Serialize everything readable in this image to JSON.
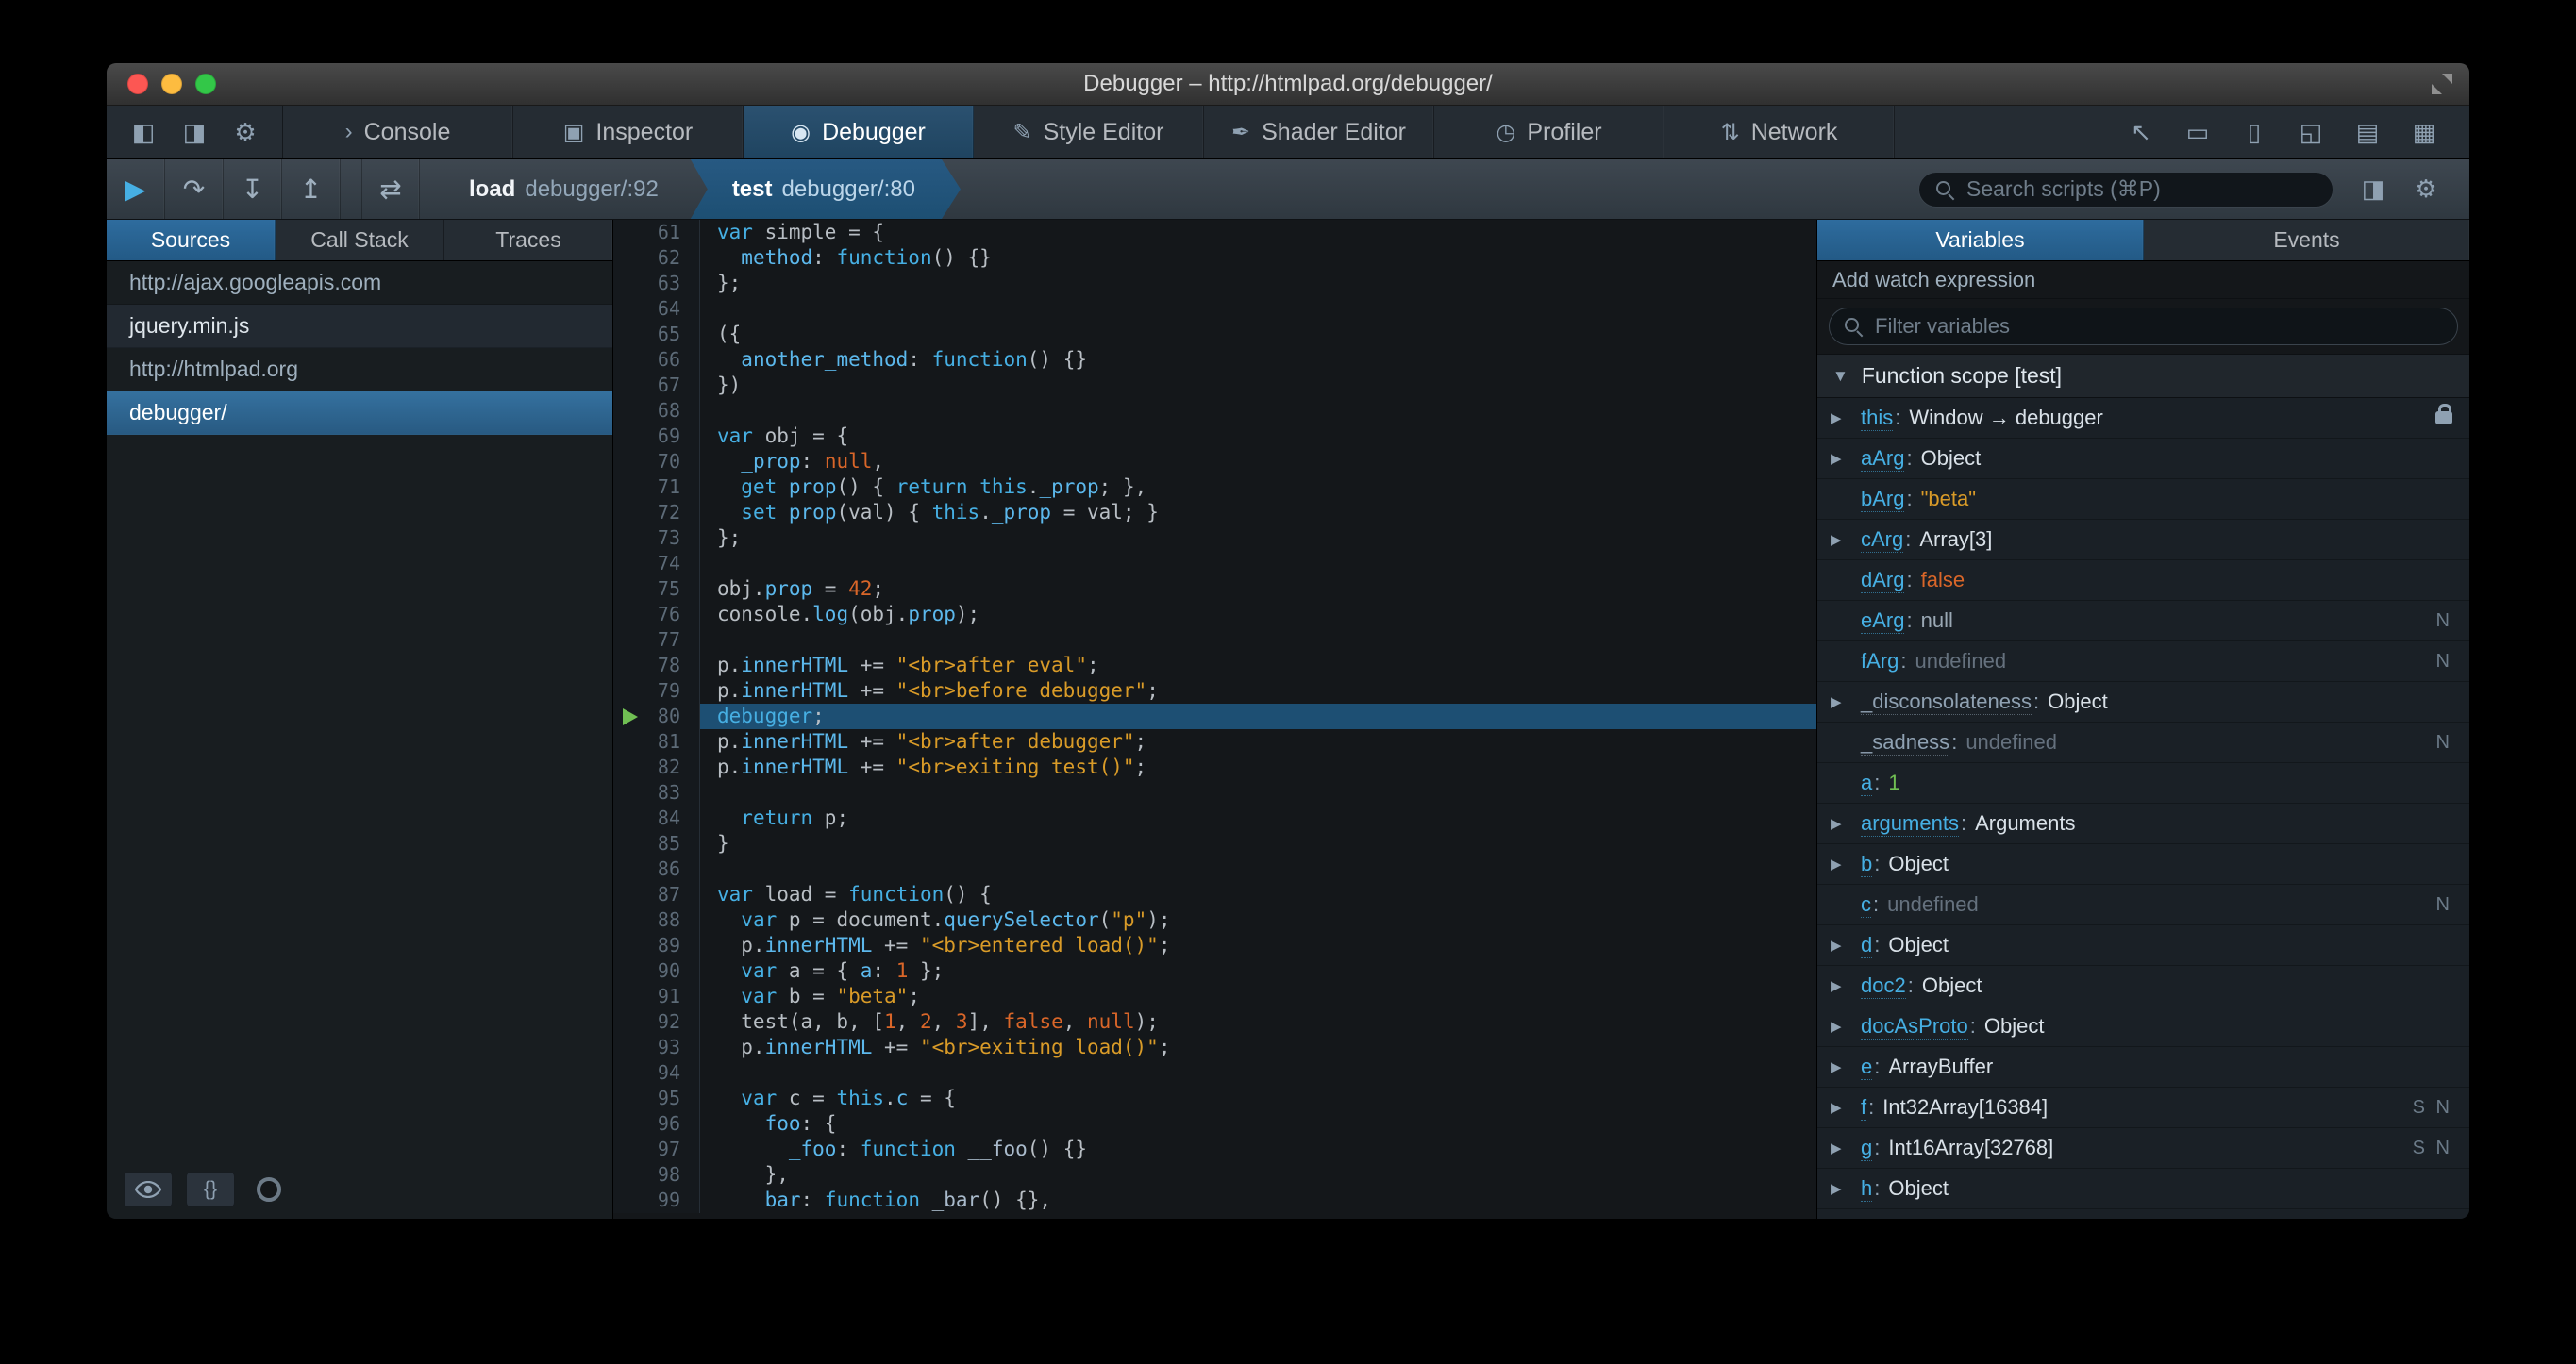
{
  "window": {
    "title": "Debugger – http://htmlpad.org/debugger/"
  },
  "colors": {
    "accent_blue": "#46afe3",
    "selection_blue": "#1d4f73",
    "string_orange": "#d99b28",
    "number_orange": "#d96629",
    "exec_green": "#70bf53",
    "panel_background": "#181d20",
    "toolbar_background": "#343c45"
  },
  "icons": {
    "caret_right": "▶",
    "caret_down": "▼"
  },
  "toolbar": {
    "left_icons": [
      {
        "name": "dock-side-icon",
        "glyph": "◧"
      },
      {
        "name": "dock-window-icon",
        "glyph": "◨"
      },
      {
        "name": "settings-gear-icon",
        "glyph": "⚙"
      }
    ],
    "tabs": [
      {
        "label": "Console",
        "icon": "console-icon",
        "glyph": "›"
      },
      {
        "label": "Inspector",
        "icon": "inspector-icon",
        "glyph": "▣"
      },
      {
        "label": "Debugger",
        "icon": "debugger-icon",
        "glyph": "◉"
      },
      {
        "label": "Style Editor",
        "icon": "style-editor-icon",
        "glyph": "✎"
      },
      {
        "label": "Shader Editor",
        "icon": "shader-editor-icon",
        "glyph": "✒"
      },
      {
        "label": "Profiler",
        "icon": "profiler-icon",
        "glyph": "◷"
      },
      {
        "label": "Network",
        "icon": "network-icon",
        "glyph": "⇅"
      }
    ],
    "active_tab": "Debugger",
    "right_icons": [
      {
        "name": "pick-element-icon",
        "glyph": "↖"
      },
      {
        "name": "split-console-icon",
        "glyph": "▭"
      },
      {
        "name": "responsive-mode-icon",
        "glyph": "▯"
      },
      {
        "name": "paint-flashing-icon",
        "glyph": "◱"
      },
      {
        "name": "scratchpad-icon",
        "glyph": "▤"
      },
      {
        "name": "tilt-3d-icon",
        "glyph": "▦"
      }
    ]
  },
  "debugger_toolbar": {
    "controls": [
      {
        "name": "resume-button",
        "glyph": "▶",
        "accent": true
      },
      {
        "name": "step-over-button",
        "glyph": "↷"
      },
      {
        "name": "step-in-button",
        "glyph": "↧"
      },
      {
        "name": "step-out-button",
        "glyph": "↥"
      },
      {
        "name": "toggle-pause-exceptions-button",
        "glyph": "⇄",
        "gap": true
      }
    ],
    "breadcrumbs": [
      {
        "fn": "load",
        "loc": "debugger/:92",
        "active": false
      },
      {
        "fn": "test",
        "loc": "debugger/:80",
        "active": true
      }
    ],
    "search_placeholder": "Search scripts (⌘P)",
    "right_icons": [
      {
        "name": "toggle-panel-icon",
        "glyph": "◨"
      },
      {
        "name": "debugger-settings-gear-icon",
        "glyph": "⚙"
      }
    ]
  },
  "sources_panel": {
    "tabs": [
      "Sources",
      "Call Stack",
      "Traces"
    ],
    "active_tab": "Sources",
    "items": [
      {
        "label": "http://ajax.googleapis.com",
        "type": "group",
        "selected": false
      },
      {
        "label": "jquery.min.js",
        "type": "file",
        "selected": false
      },
      {
        "label": "http://htmlpad.org",
        "type": "group",
        "selected": false
      },
      {
        "label": "debugger/",
        "type": "file",
        "selected": true
      }
    ],
    "footer": {
      "pretty_print_label": "{}"
    }
  },
  "editor": {
    "current_line": 80,
    "lines": [
      {
        "n": 61,
        "t": [
          [
            "k",
            "var"
          ],
          [
            "p",
            " simple = {"
          ]
        ]
      },
      {
        "n": 62,
        "t": [
          [
            "p",
            "  "
          ],
          [
            "pr",
            "method"
          ],
          [
            "p",
            ": "
          ],
          [
            "k",
            "function"
          ],
          [
            "p",
            "() {}"
          ]
        ]
      },
      {
        "n": 63,
        "t": [
          [
            "p",
            "};"
          ]
        ]
      },
      {
        "n": 64,
        "t": []
      },
      {
        "n": 65,
        "t": [
          [
            "p",
            "({"
          ]
        ]
      },
      {
        "n": 66,
        "t": [
          [
            "p",
            "  "
          ],
          [
            "pr",
            "another_method"
          ],
          [
            "p",
            ": "
          ],
          [
            "k",
            "function"
          ],
          [
            "p",
            "() {}"
          ]
        ]
      },
      {
        "n": 67,
        "t": [
          [
            "p",
            "})"
          ]
        ]
      },
      {
        "n": 68,
        "t": []
      },
      {
        "n": 69,
        "t": [
          [
            "k",
            "var"
          ],
          [
            "p",
            " obj = {"
          ]
        ]
      },
      {
        "n": 70,
        "t": [
          [
            "p",
            "  "
          ],
          [
            "pr",
            "_prop"
          ],
          [
            "p",
            ": "
          ],
          [
            "a",
            "null"
          ],
          [
            "p",
            ","
          ]
        ]
      },
      {
        "n": 71,
        "t": [
          [
            "p",
            "  "
          ],
          [
            "k",
            "get"
          ],
          [
            "p",
            " "
          ],
          [
            "pr",
            "prop"
          ],
          [
            "p",
            "() { "
          ],
          [
            "k",
            "return"
          ],
          [
            "p",
            " "
          ],
          [
            "k",
            "this"
          ],
          [
            "p",
            "."
          ],
          [
            "pr",
            "_prop"
          ],
          [
            "p",
            "; },"
          ]
        ]
      },
      {
        "n": 72,
        "t": [
          [
            "p",
            "  "
          ],
          [
            "k",
            "set"
          ],
          [
            "p",
            " "
          ],
          [
            "pr",
            "prop"
          ],
          [
            "p",
            "(val) { "
          ],
          [
            "k",
            "this"
          ],
          [
            "p",
            "."
          ],
          [
            "pr",
            "_prop"
          ],
          [
            "p",
            " = val; }"
          ]
        ]
      },
      {
        "n": 73,
        "t": [
          [
            "p",
            "};"
          ]
        ]
      },
      {
        "n": 74,
        "t": []
      },
      {
        "n": 75,
        "t": [
          [
            "p",
            "obj."
          ],
          [
            "pr",
            "prop"
          ],
          [
            "p",
            " = "
          ],
          [
            "n",
            "42"
          ],
          [
            "p",
            ";"
          ]
        ]
      },
      {
        "n": 76,
        "t": [
          [
            "p",
            "console."
          ],
          [
            "pr",
            "log"
          ],
          [
            "p",
            "(obj."
          ],
          [
            "pr",
            "prop"
          ],
          [
            "p",
            ");"
          ]
        ]
      },
      {
        "n": 77,
        "t": []
      },
      {
        "n": 78,
        "t": [
          [
            "p",
            "p."
          ],
          [
            "pr",
            "innerHTML"
          ],
          [
            "p",
            " += "
          ],
          [
            "s",
            "\"<br>after eval\""
          ],
          [
            "p",
            ";"
          ]
        ]
      },
      {
        "n": 79,
        "t": [
          [
            "p",
            "p."
          ],
          [
            "pr",
            "innerHTML"
          ],
          [
            "p",
            " += "
          ],
          [
            "s",
            "\"<br>before debugger\""
          ],
          [
            "p",
            ";"
          ]
        ]
      },
      {
        "n": 80,
        "t": [
          [
            "k",
            "debugger"
          ],
          [
            "p",
            ";"
          ]
        ]
      },
      {
        "n": 81,
        "t": [
          [
            "p",
            "p."
          ],
          [
            "pr",
            "innerHTML"
          ],
          [
            "p",
            " += "
          ],
          [
            "s",
            "\"<br>after debugger\""
          ],
          [
            "p",
            ";"
          ]
        ]
      },
      {
        "n": 82,
        "t": [
          [
            "p",
            "p."
          ],
          [
            "pr",
            "innerHTML"
          ],
          [
            "p",
            " += "
          ],
          [
            "s",
            "\"<br>exiting test()\""
          ],
          [
            "p",
            ";"
          ]
        ]
      },
      {
        "n": 83,
        "t": []
      },
      {
        "n": 84,
        "t": [
          [
            "p",
            "  "
          ],
          [
            "k",
            "return"
          ],
          [
            "p",
            " p;"
          ]
        ]
      },
      {
        "n": 85,
        "t": [
          [
            "p",
            "}"
          ]
        ]
      },
      {
        "n": 86,
        "t": []
      },
      {
        "n": 87,
        "t": [
          [
            "k",
            "var"
          ],
          [
            "p",
            " load = "
          ],
          [
            "k",
            "function"
          ],
          [
            "p",
            "() {"
          ]
        ]
      },
      {
        "n": 88,
        "t": [
          [
            "p",
            "  "
          ],
          [
            "k",
            "var"
          ],
          [
            "p",
            " p = document."
          ],
          [
            "pr",
            "querySelector"
          ],
          [
            "p",
            "("
          ],
          [
            "s",
            "\"p\""
          ],
          [
            "p",
            ");"
          ]
        ]
      },
      {
        "n": 89,
        "t": [
          [
            "p",
            "  p."
          ],
          [
            "pr",
            "innerHTML"
          ],
          [
            "p",
            " += "
          ],
          [
            "s",
            "\"<br>entered load()\""
          ],
          [
            "p",
            ";"
          ]
        ]
      },
      {
        "n": 90,
        "t": [
          [
            "p",
            "  "
          ],
          [
            "k",
            "var"
          ],
          [
            "p",
            " a = { "
          ],
          [
            "pr",
            "a"
          ],
          [
            "p",
            ": "
          ],
          [
            "n",
            "1"
          ],
          [
            "p",
            " };"
          ]
        ]
      },
      {
        "n": 91,
        "t": [
          [
            "p",
            "  "
          ],
          [
            "k",
            "var"
          ],
          [
            "p",
            " b = "
          ],
          [
            "s",
            "\"beta\""
          ],
          [
            "p",
            ";"
          ]
        ]
      },
      {
        "n": 92,
        "t": [
          [
            "p",
            "  test(a, b, ["
          ],
          [
            "n",
            "1"
          ],
          [
            "p",
            ", "
          ],
          [
            "n",
            "2"
          ],
          [
            "p",
            ", "
          ],
          [
            "n",
            "3"
          ],
          [
            "p",
            "], "
          ],
          [
            "a",
            "false"
          ],
          [
            "p",
            ", "
          ],
          [
            "a",
            "null"
          ],
          [
            "p",
            ");"
          ]
        ]
      },
      {
        "n": 93,
        "t": [
          [
            "p",
            "  p."
          ],
          [
            "pr",
            "innerHTML"
          ],
          [
            "p",
            " += "
          ],
          [
            "s",
            "\"<br>exiting load()\""
          ],
          [
            "p",
            ";"
          ]
        ]
      },
      {
        "n": 94,
        "t": []
      },
      {
        "n": 95,
        "t": [
          [
            "p",
            "  "
          ],
          [
            "k",
            "var"
          ],
          [
            "p",
            " c = "
          ],
          [
            "k",
            "this"
          ],
          [
            "p",
            "."
          ],
          [
            "pr",
            "c"
          ],
          [
            "p",
            " = {"
          ]
        ]
      },
      {
        "n": 96,
        "t": [
          [
            "p",
            "    "
          ],
          [
            "pr",
            "foo"
          ],
          [
            "p",
            ": {"
          ]
        ]
      },
      {
        "n": 97,
        "t": [
          [
            "p",
            "      "
          ],
          [
            "pr",
            "_foo"
          ],
          [
            "p",
            ": "
          ],
          [
            "k",
            "function"
          ],
          [
            "p",
            " "
          ],
          [
            "d",
            "__foo"
          ],
          [
            "p",
            "() {}"
          ]
        ]
      },
      {
        "n": 98,
        "t": [
          [
            "p",
            "    },"
          ]
        ]
      },
      {
        "n": 99,
        "t": [
          [
            "p",
            "    "
          ],
          [
            "pr",
            "bar"
          ],
          [
            "p",
            ": "
          ],
          [
            "k",
            "function"
          ],
          [
            "p",
            " "
          ],
          [
            "d",
            "_bar"
          ],
          [
            "p",
            "() {},"
          ]
        ]
      }
    ]
  },
  "variables_panel": {
    "tabs": [
      "Variables",
      "Events"
    ],
    "active_tab": "Variables",
    "watch_label": "Add watch expression",
    "filter_placeholder": "Filter variables",
    "scope_label": "Function scope [test]",
    "variables": [
      {
        "name": "this",
        "value": "Window → debugger",
        "type": "obj",
        "expand": true,
        "badge": "lock"
      },
      {
        "name": "aArg",
        "value": "Object",
        "type": "obj",
        "expand": true
      },
      {
        "name": "bArg",
        "value": "\"beta\"",
        "type": "str",
        "expand": false
      },
      {
        "name": "cArg",
        "value": "Array[3]",
        "type": "obj",
        "expand": true
      },
      {
        "name": "dArg",
        "value": "false",
        "type": "bool",
        "expand": false
      },
      {
        "name": "eArg",
        "value": "null",
        "type": "nul",
        "expand": false,
        "badge": "N"
      },
      {
        "name": "fArg",
        "value": "undefined",
        "type": "undef",
        "expand": false,
        "badge": "N"
      },
      {
        "name": "_disconsolateness",
        "value": "Object",
        "type": "obj",
        "expand": true,
        "dim": true
      },
      {
        "name": "_sadness",
        "value": "undefined",
        "type": "undef",
        "expand": false,
        "badge": "N",
        "dim": true
      },
      {
        "name": "a",
        "value": "1",
        "type": "num",
        "expand": false
      },
      {
        "name": "arguments",
        "value": "Arguments",
        "type": "obj",
        "expand": true
      },
      {
        "name": "b",
        "value": "Object",
        "type": "obj",
        "expand": true
      },
      {
        "name": "c",
        "value": "undefined",
        "type": "undef",
        "expand": false,
        "badge": "N"
      },
      {
        "name": "d",
        "value": "Object",
        "type": "obj",
        "expand": true
      },
      {
        "name": "doc2",
        "value": "Object",
        "type": "obj",
        "expand": true
      },
      {
        "name": "docAsProto",
        "value": "Object",
        "type": "obj",
        "expand": true
      },
      {
        "name": "e",
        "value": "ArrayBuffer",
        "type": "obj",
        "expand": true
      },
      {
        "name": "f",
        "value": "Int32Array[16384]",
        "type": "obj",
        "expand": true,
        "badge": "S N"
      },
      {
        "name": "g",
        "value": "Int16Array[32768]",
        "type": "obj",
        "expand": true,
        "badge": "S N"
      },
      {
        "name": "h",
        "value": "Object",
        "type": "obj",
        "expand": true
      }
    ]
  }
}
